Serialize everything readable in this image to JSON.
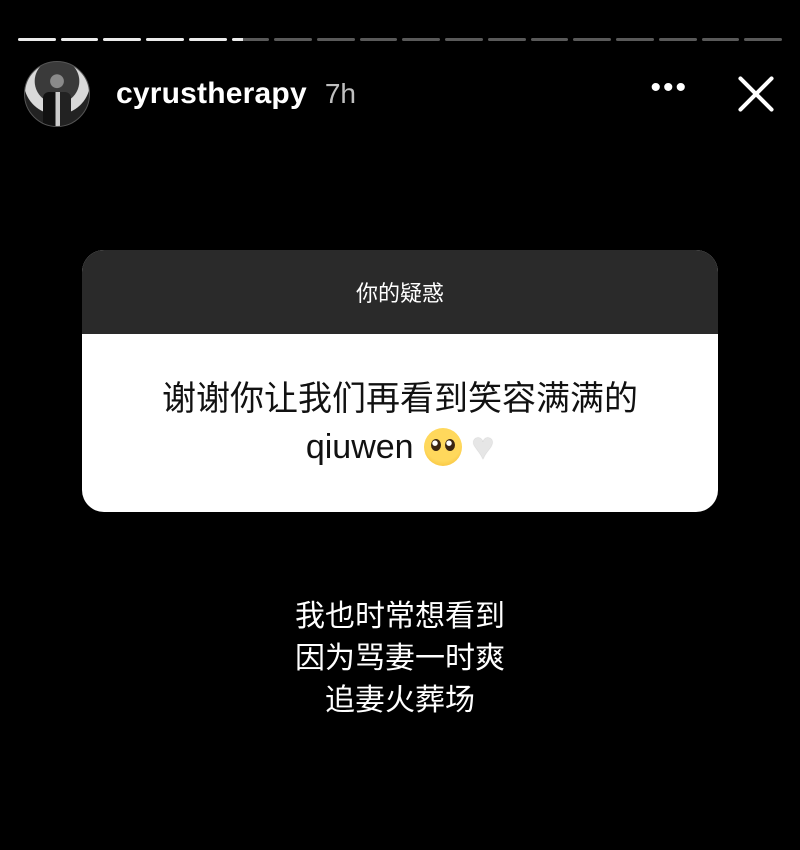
{
  "story": {
    "progress": {
      "segments_total": 18,
      "segments_seen": 5,
      "current_fraction": 0.3
    },
    "header": {
      "username": "cyrustherapy",
      "time": "7h",
      "more_icon": "more-horizontal-icon",
      "close_icon": "close-icon"
    },
    "question_sticker": {
      "title": "你的疑惑",
      "text_line1": "谢谢你让我们再看到笑容满满的",
      "text_line2": "qiuwen",
      "emojis": [
        "pleading-face-emoji",
        "white-heart-emoji"
      ]
    },
    "caption": {
      "line1": "我也时常想看到",
      "line2": "因为骂妻一时爽",
      "line3": "追妻火葬场"
    }
  }
}
